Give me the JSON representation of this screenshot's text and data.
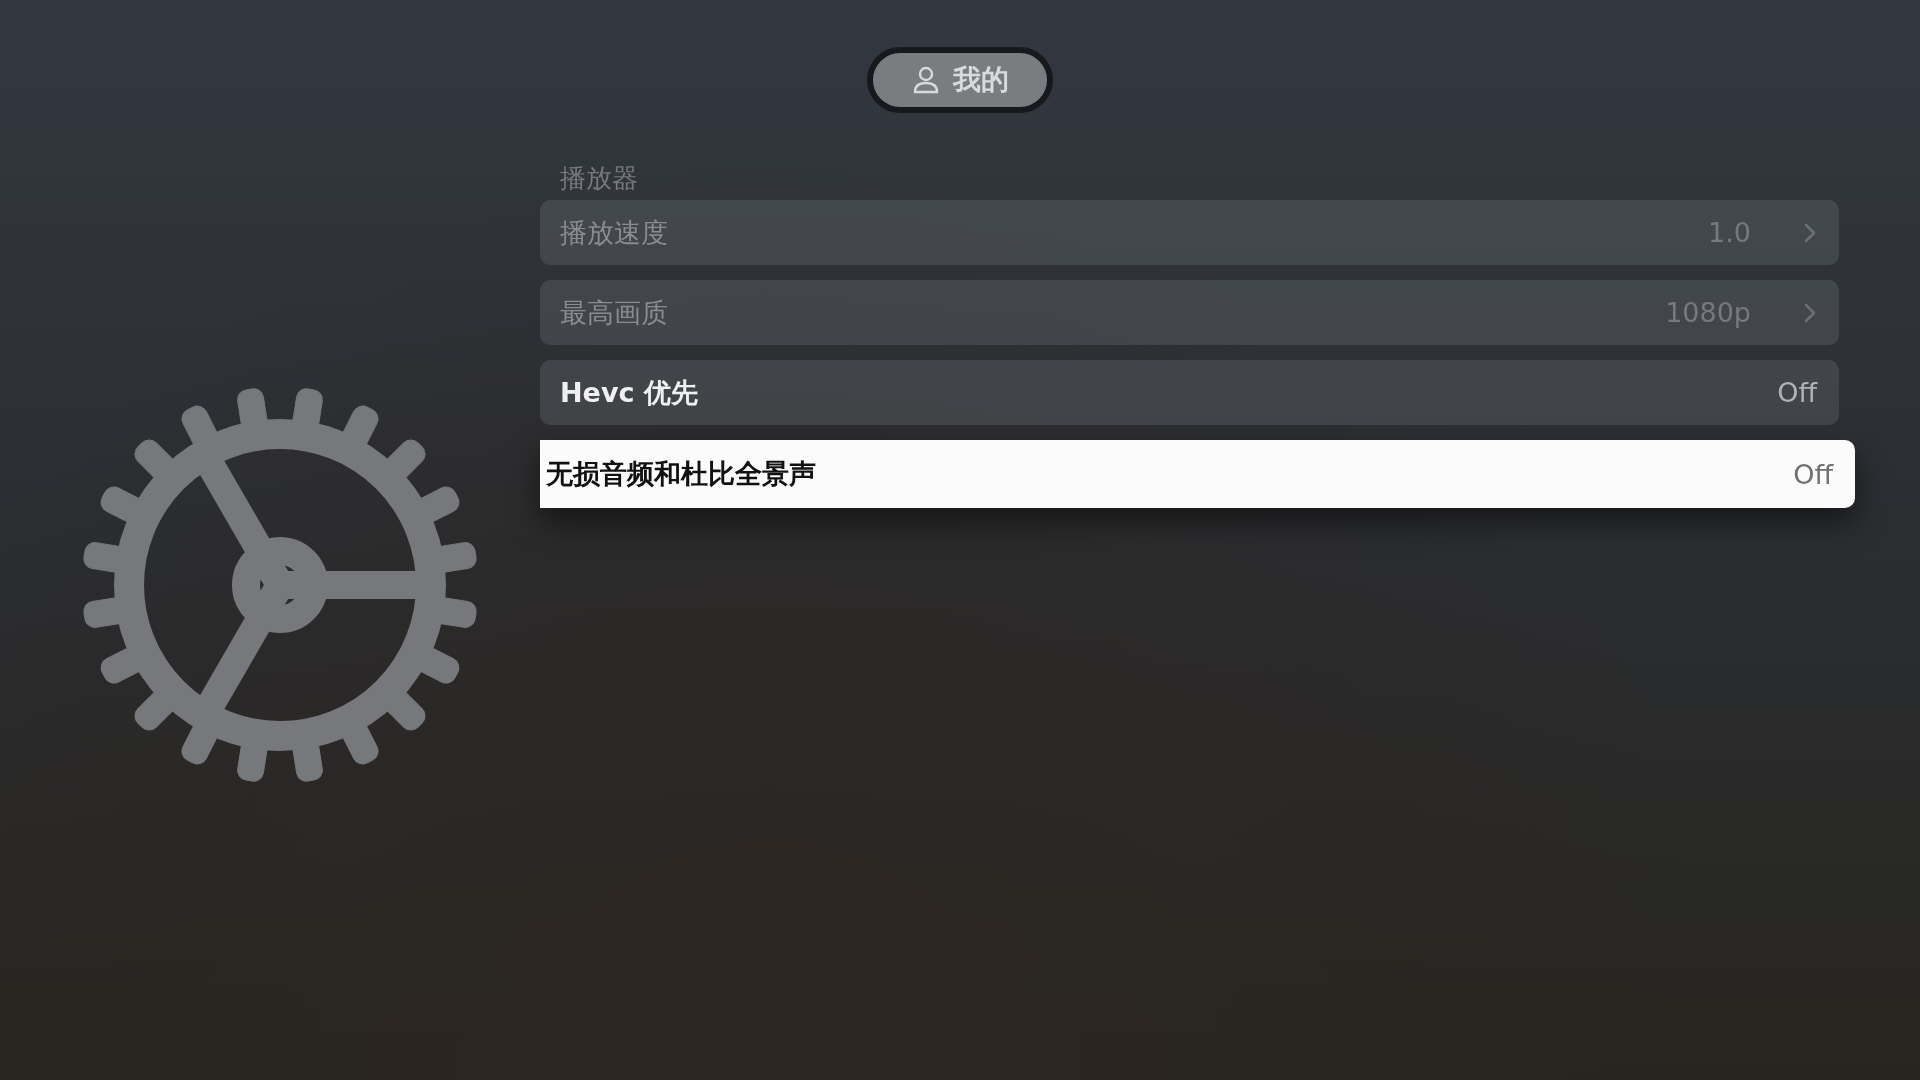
{
  "top_tab": {
    "label": "我的",
    "selected": true
  },
  "section": {
    "title": "播放器",
    "rows": [
      {
        "kind": "link",
        "label": "播放速度",
        "value": "1.0",
        "disabled": true,
        "focused": false
      },
      {
        "kind": "link",
        "label": "最高画质",
        "value": "1080p",
        "disabled": true,
        "focused": false
      },
      {
        "kind": "toggle",
        "label": "Hevc 优先",
        "value": "Off",
        "disabled": false,
        "focused": false
      },
      {
        "kind": "toggle",
        "label": "无损音频和杜比全景声",
        "value": "Off",
        "disabled": false,
        "focused": true
      }
    ]
  }
}
